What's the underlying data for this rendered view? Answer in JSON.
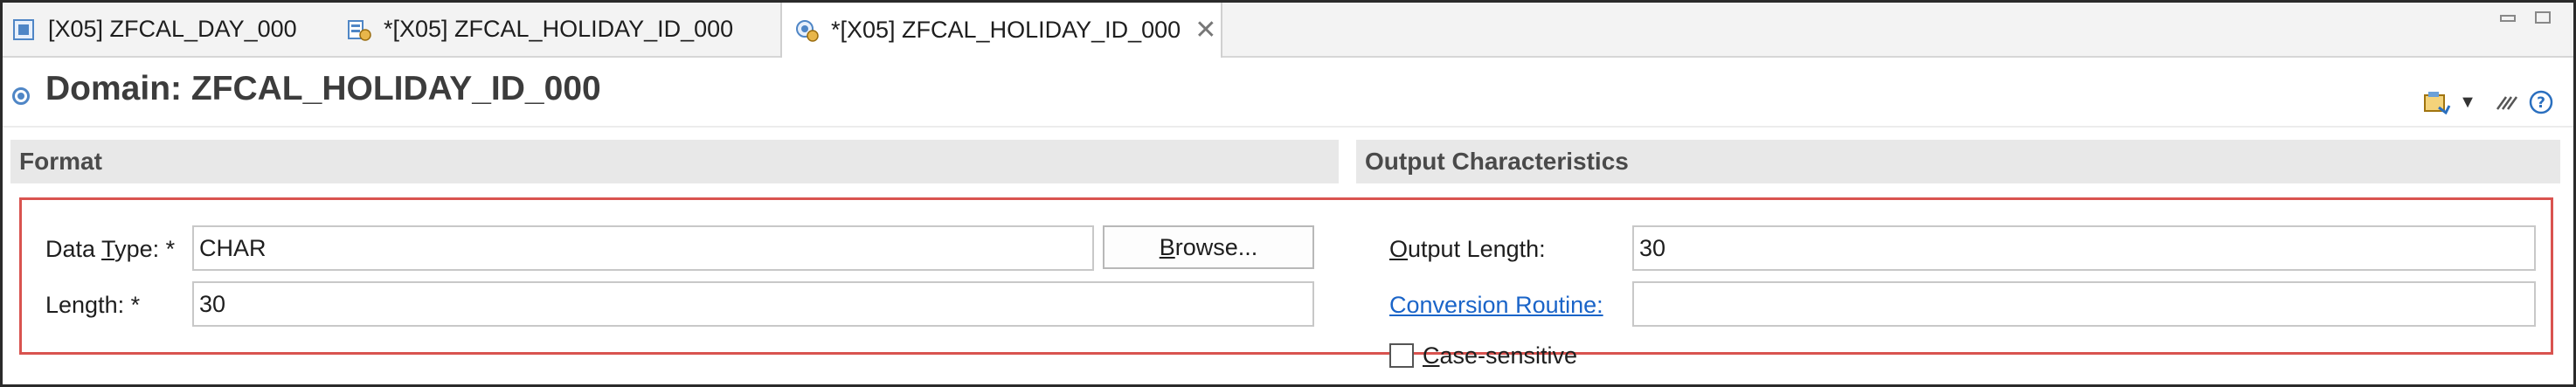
{
  "tabs": [
    {
      "label": "[X05] ZFCAL_DAY_000",
      "icon": "domain-icon"
    },
    {
      "label": "*[X05] ZFCAL_HOLIDAY_ID_000",
      "icon": "data-element-icon"
    },
    {
      "label": "*[X05] ZFCAL_HOLIDAY_ID_000",
      "icon": "domain-icon",
      "active": true,
      "close": "✕"
    }
  ],
  "header": {
    "title": "Domain: ZFCAL_HOLIDAY_ID_000",
    "toolbar": {
      "dropdown_glyph": "▼",
      "help_glyph": "?"
    }
  },
  "format": {
    "section_title": "Format",
    "data_type_label_pre": "Data ",
    "data_type_label_mn": "T",
    "data_type_label_post": "ype: *",
    "data_type_value": "CHAR",
    "browse_mn": "B",
    "browse_rest": "rowse...",
    "length_label": "Length: *",
    "length_value": "30"
  },
  "output": {
    "section_title": "Output Characteristics",
    "output_length_label_mn": "O",
    "output_length_label_rest": "utput Length:",
    "output_length_value": "30",
    "conversion_routine_mn": "C",
    "conversion_routine_rest": "onversion Routine:",
    "conversion_routine_value": "",
    "case_sensitive_mn": "C",
    "case_sensitive_rest": "ase-sensitive"
  }
}
